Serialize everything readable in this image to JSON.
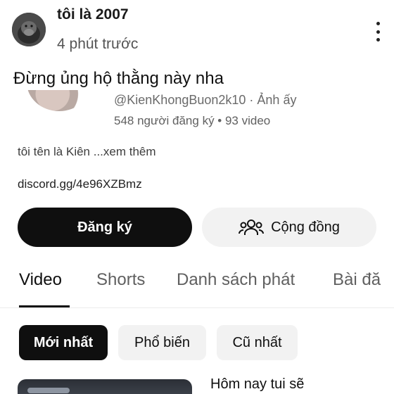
{
  "post": {
    "username": "tôi là 2007",
    "time": "4 phút trước",
    "caption": "Đừng ủng hộ thằng này nha",
    "more_icon": "vertical-ellipsis-icon"
  },
  "channel": {
    "handle": "@KienKhongBuon2k10 · Ảnh ấy",
    "stats": "548 người đăng ký • 93 video",
    "description": "tôi tên là Kiên ...xem thêm",
    "link": "discord.gg/4e96XZBmz",
    "subscribe_label": "Đăng ký",
    "community_label": "Cộng đồng",
    "community_icon": "people-icon"
  },
  "tabs": [
    "Video",
    "Shorts",
    "Danh sách phát",
    "Bài đă"
  ],
  "active_tab": "Video",
  "filters": [
    "Mới nhất",
    "Phổ biến",
    "Cũ nhất"
  ],
  "active_filter": "Mới nhất",
  "video": {
    "title": "Hôm nay tui sẽ"
  },
  "colors": {
    "primary_text": "#0f0f0f",
    "secondary_text": "#606060",
    "chip_bg": "#f2f2f2",
    "dark_button": "#0f0f0f"
  }
}
